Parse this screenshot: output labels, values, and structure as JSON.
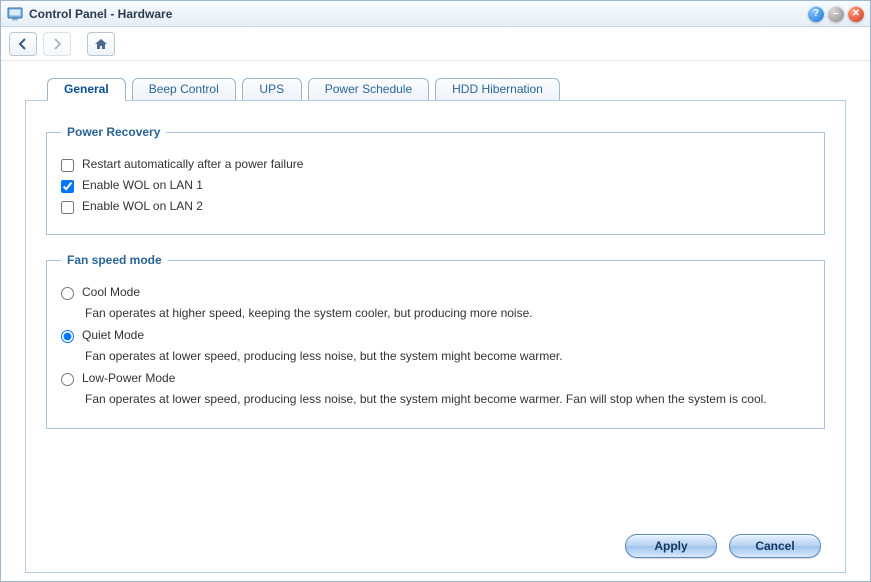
{
  "window": {
    "title": "Control Panel - Hardware"
  },
  "tabs": [
    {
      "label": "General"
    },
    {
      "label": "Beep Control"
    },
    {
      "label": "UPS"
    },
    {
      "label": "Power Schedule"
    },
    {
      "label": "HDD Hibernation"
    }
  ],
  "active_tab": 0,
  "power_recovery": {
    "legend": "Power Recovery",
    "options": [
      {
        "label": "Restart automatically after a power failure",
        "checked": false
      },
      {
        "label": "Enable WOL on LAN 1",
        "checked": true
      },
      {
        "label": "Enable WOL on LAN 2",
        "checked": false
      }
    ]
  },
  "fan_speed": {
    "legend": "Fan speed mode",
    "selected": 1,
    "modes": [
      {
        "label": "Cool Mode",
        "desc": "Fan operates at higher speed, keeping the system cooler, but producing more noise."
      },
      {
        "label": "Quiet Mode",
        "desc": "Fan operates at lower speed, producing less noise, but the system might become warmer."
      },
      {
        "label": "Low-Power Mode",
        "desc": "Fan operates at lower speed, producing less noise, but the system might become warmer. Fan will stop when the system is cool."
      }
    ]
  },
  "buttons": {
    "apply": "Apply",
    "cancel": "Cancel"
  },
  "title_button_glyphs": {
    "help": "?",
    "min": "–",
    "close": "✕"
  }
}
